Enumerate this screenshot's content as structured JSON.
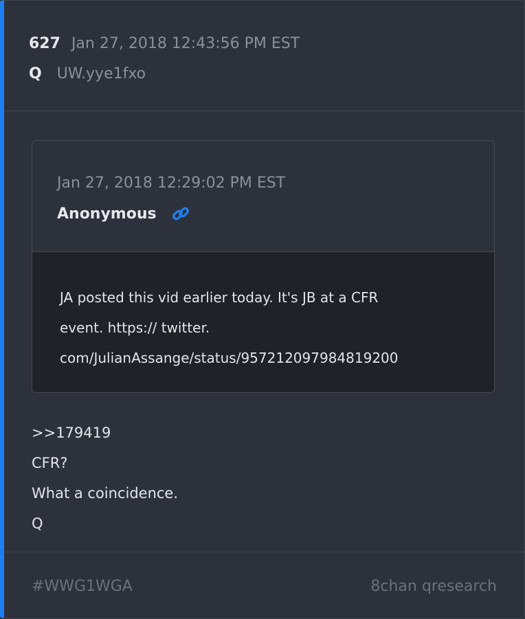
{
  "post": {
    "number": "627",
    "date": "Jan 27, 2018 12:43:56 PM EST",
    "author": "Q",
    "tripcode": "UW.yye1fxo"
  },
  "quoted_post": {
    "date": "Jan 27, 2018 12:29:02 PM EST",
    "author": "Anonymous",
    "link_icon": "link-icon",
    "lines": [
      "JA posted this vid earlier today. It's JB at a CFR",
      "event. https:// twitter.",
      "com/JulianAssange/status/957212097984819200"
    ]
  },
  "message": {
    "lines": [
      ">>179419",
      "CFR?",
      "What a coincidence.",
      "Q"
    ]
  },
  "footer": {
    "hashtag": "#WWG1WGA",
    "source": "8chan qresearch"
  },
  "colors": {
    "accent": "#1e7ff2",
    "card_background": "#2d313b",
    "quote_body_background": "#202227",
    "link_icon": "#1e7ff2"
  }
}
